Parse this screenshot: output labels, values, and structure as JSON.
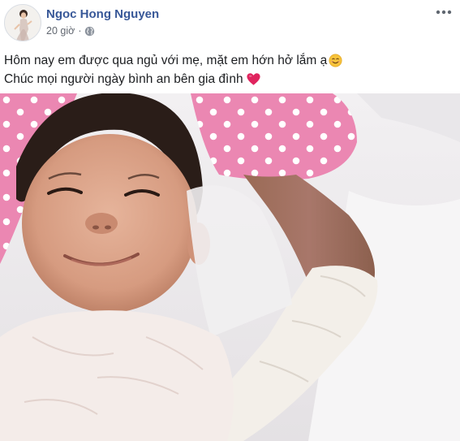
{
  "post": {
    "author": "Ngoc Hong Nguyen",
    "time": "20 giờ",
    "privacy_icon": "globe-icon",
    "more_icon": "more-options-icon",
    "caption_line1": "Hôm nay em được qua ngủ với mẹ, mặt em hớn hở lắm ạ",
    "caption_line1_emoji": "smiling-face-emoji",
    "caption_line2": "Chúc mọi người ngày bình an bên gia đình",
    "caption_line2_emoji": "red-heart-emoji",
    "photo": "child-smiling-in-bed-photo"
  },
  "colors": {
    "author": "#385898",
    "meta": "#616770",
    "text": "#1c1e21",
    "pink_pillow": "#ec8bb4",
    "heart": "#e0245e"
  }
}
